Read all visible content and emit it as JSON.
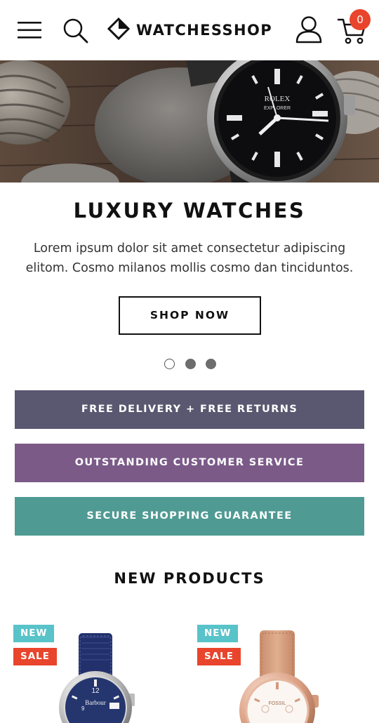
{
  "header": {
    "menu_icon": "hamburger-menu-icon",
    "search_icon": "search-icon",
    "logo_text": "WATCHESSHOP",
    "logo_icon": "diamond-logo-icon",
    "account_icon": "user-icon",
    "cart_icon": "cart-icon",
    "cart_count": "0",
    "badge_color": "#e8452c"
  },
  "hero": {
    "title": "LUXURY WATCHES",
    "description": "Lorem ipsum dolor sit amet consectetur adipiscing elitom. Cosmo milanos mollis cosmo dan tinciduntos.",
    "cta_label": "SHOP NOW",
    "watch_brand": "ROLEX",
    "watch_model": "EXPLORER",
    "slides_total": 3,
    "active_slide": 1
  },
  "info_bars": [
    {
      "label": "FREE DELIVERY + FREE RETURNS",
      "color": "#5a5770"
    },
    {
      "label": "OUTSTANDING CUSTOMER SERVICE",
      "color": "#7b5a88"
    },
    {
      "label": "SECURE SHOPPING GUARANTEE",
      "color": "#4f9a93"
    }
  ],
  "new_products": {
    "title": "NEW PRODUCTS",
    "items": [
      {
        "badge_new": "NEW",
        "badge_sale": "SALE",
        "brand": "Barbour"
      },
      {
        "badge_new": "NEW",
        "badge_sale": "SALE",
        "brand": "FOSSIL"
      }
    ]
  }
}
